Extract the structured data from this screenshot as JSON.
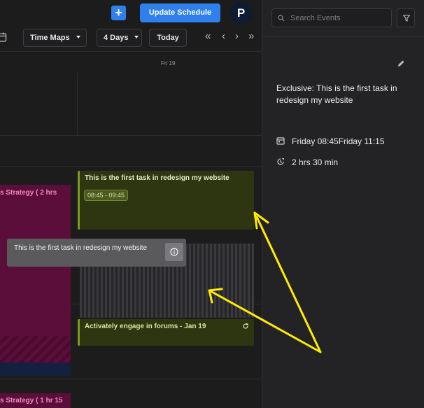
{
  "topbar": {
    "add_label": "+",
    "update_label": "Update Schedule",
    "avatar_initial": "P"
  },
  "toolbar": {
    "time_maps_label": "Time Maps",
    "days_label": "4 Days",
    "today_label": "Today",
    "nav_first": "«",
    "nav_prev": "‹",
    "nav_next": "›",
    "nav_last": "»"
  },
  "calendar": {
    "day_label": "Fri 19",
    "left_event_label": "s Strategy ( 2 hrs",
    "left_event_2_label": "s Strategy ( 1 hr 15",
    "event1": {
      "title": "This is the first task in redesign my website",
      "time": "08:45 - 09:45"
    },
    "event2": {
      "title": "Activately engage in forums - Jan 19"
    },
    "tooltip": {
      "text": "This is the first task in redesign my website"
    },
    "colors": {
      "event_green": "#2e3511",
      "event_border": "#7d9a1f",
      "event_magenta": "#5c0e3a",
      "accent_blue": "#2f80ed",
      "annotation_yellow": "#ffec00"
    }
  },
  "panel": {
    "search_placeholder": "Search Events",
    "detail_title": "Exclusive: This is the first task in redesign my website",
    "detail_time": "Friday 08:45Friday 11:15",
    "detail_duration": "2 hrs 30 min"
  },
  "icons": [
    "calendar-icon",
    "search-icon",
    "filter-icon",
    "edit-icon",
    "repeat-icon",
    "info-icon",
    "clock-icon"
  ]
}
